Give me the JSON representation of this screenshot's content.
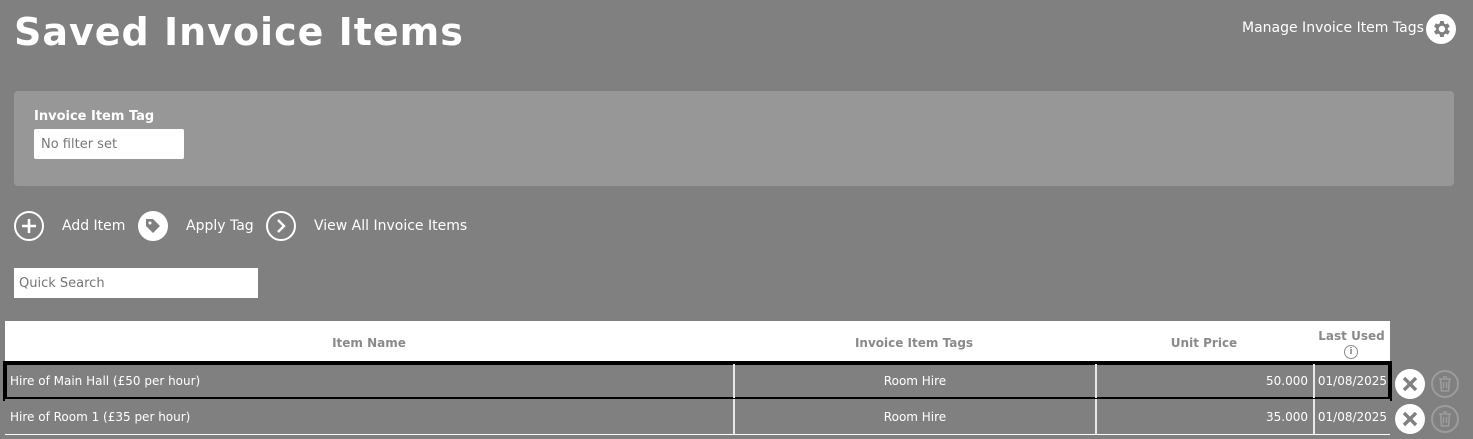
{
  "header": {
    "title": "Saved Invoice Items",
    "manage_tags_label": "Manage Invoice Item Tags"
  },
  "filter": {
    "tag_label": "Invoice Item Tag",
    "tag_value": "No filter set"
  },
  "actions": {
    "add_label": "Add Item",
    "apply_tag_label": "Apply Tag",
    "view_all_label": "View All Invoice Items"
  },
  "search": {
    "placeholder": "Quick Search"
  },
  "table": {
    "columns": {
      "item_name": "Item Name",
      "tags": "Invoice Item Tags",
      "unit_price": "Unit Price",
      "last_used": "Last Used"
    },
    "rows": [
      {
        "name": "Hire of Main Hall (£50 per hour)",
        "tags": "Room Hire",
        "price": "50.000",
        "last_used": "01/08/2025"
      },
      {
        "name": "Hire of Room 1 (£35 per hour)",
        "tags": "Room Hire",
        "price": "35.000",
        "last_used": "01/08/2025"
      }
    ]
  },
  "colors": {
    "background": "#808080",
    "panel": "#979797",
    "selected_outline": "#000000"
  }
}
